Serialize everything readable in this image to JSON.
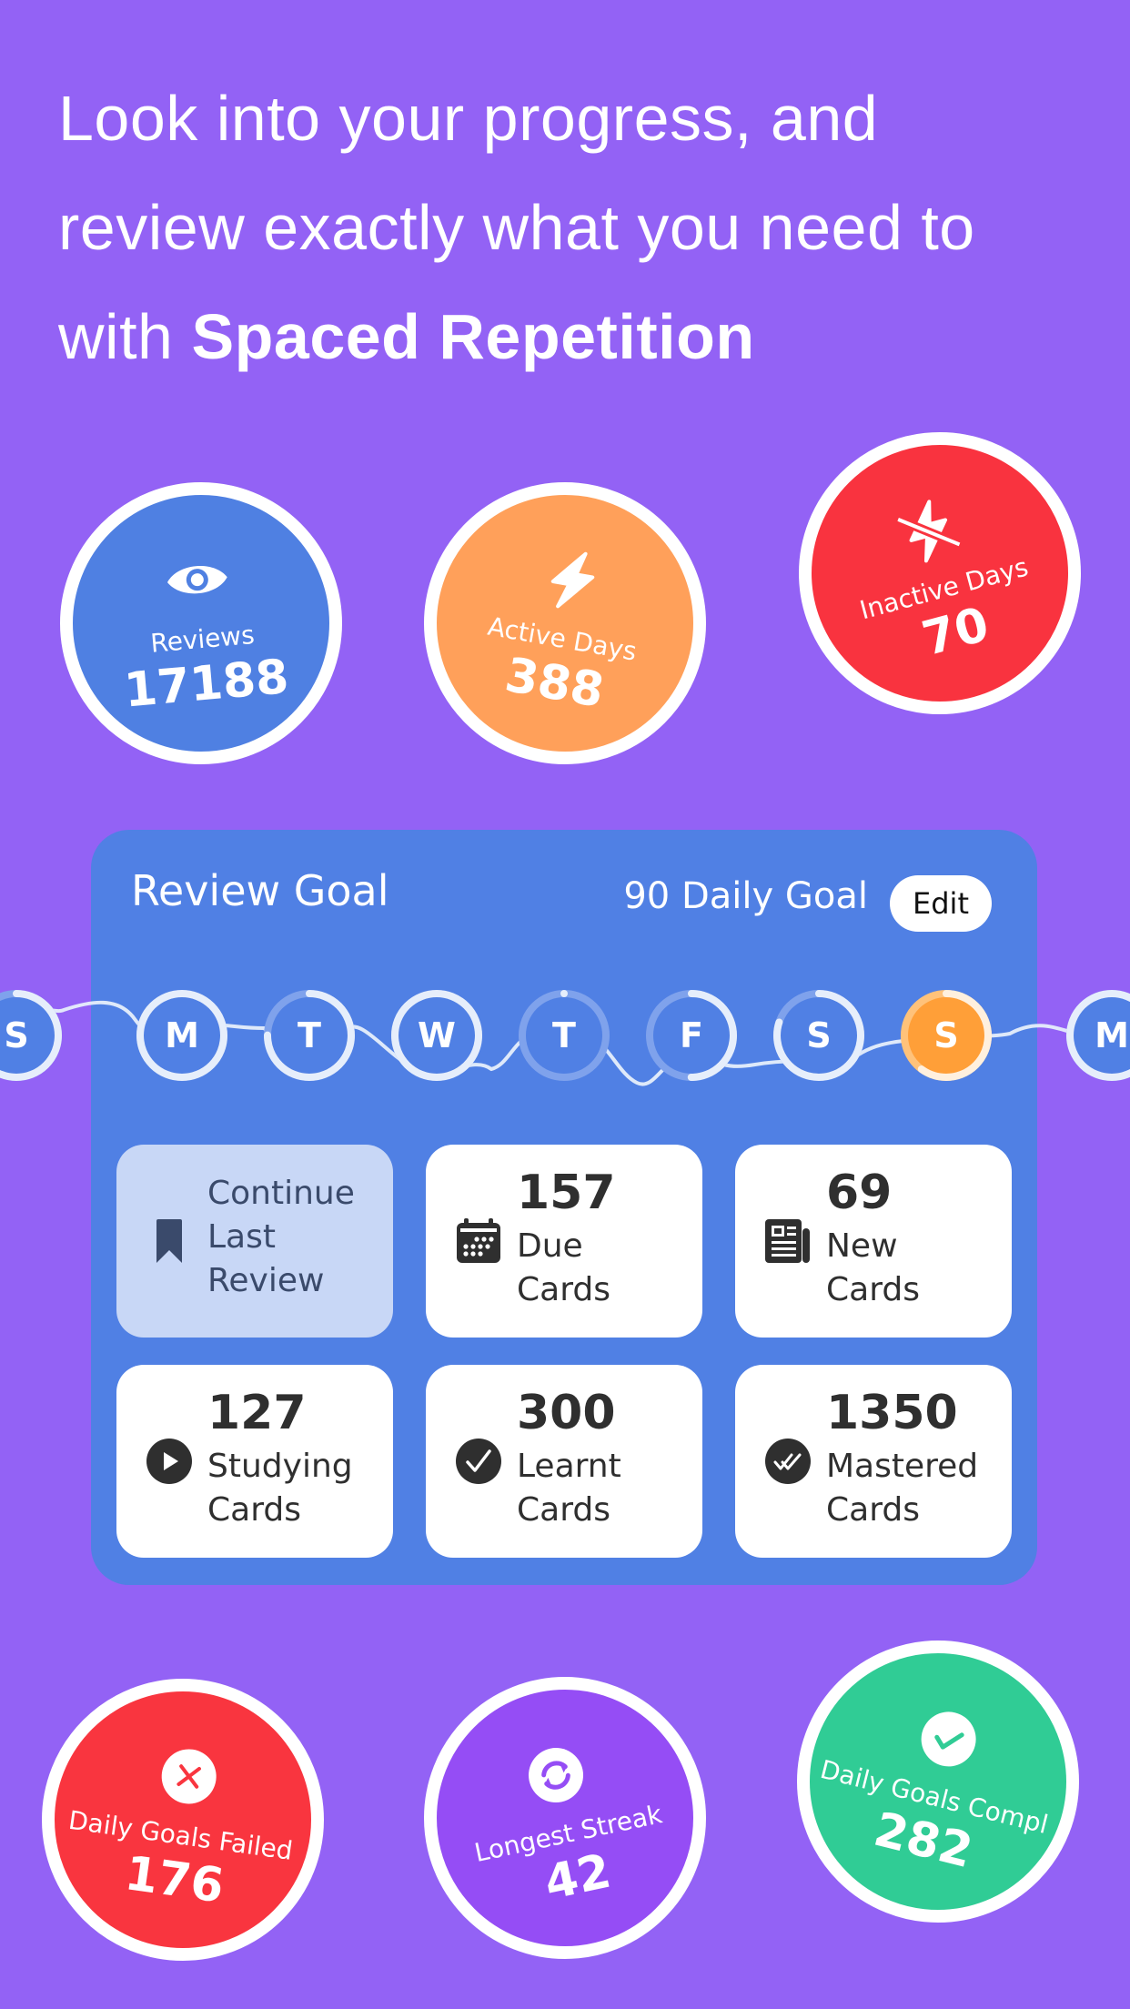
{
  "headline": {
    "line1": "Look into your progress, and",
    "line2": "review exactly what you need to",
    "line3_prefix": "with ",
    "line3_bold": "Spaced Repetition"
  },
  "colors": {
    "background": "#9362F5",
    "card": "#5080E4",
    "reviews": "#4F80E2",
    "active_days": "#FFA05A",
    "inactive_days": "#F9333F",
    "goals_failed": "#F9353F",
    "longest_streak": "#954DF5",
    "goals_completed": "#30CC95",
    "today": "#FF9F38"
  },
  "top_stats": [
    {
      "label": "Reviews",
      "value": "17188",
      "icon": "eye-icon"
    },
    {
      "label": "Active Days",
      "value": "388",
      "icon": "lightning-icon"
    },
    {
      "label": "Inactive Days",
      "value": "70",
      "icon": "lightning-off-icon"
    }
  ],
  "review_goal": {
    "title": "Review Goal",
    "daily_goal": "90 Daily Goal",
    "edit_label": "Edit",
    "days": [
      {
        "letter": "S",
        "progress": 0.85
      },
      {
        "letter": "M",
        "progress": 1.0
      },
      {
        "letter": "T",
        "progress": 0.75
      },
      {
        "letter": "W",
        "progress": 1.0
      },
      {
        "letter": "T",
        "progress": 0.0
      },
      {
        "letter": "F",
        "progress": 0.5
      },
      {
        "letter": "S",
        "progress": 0.8
      },
      {
        "letter": "S",
        "progress": 0.6,
        "today": true
      },
      {
        "letter": "M",
        "progress": 1.0
      }
    ],
    "tiles": [
      {
        "kind": "continue",
        "number": "",
        "label": "Continue\nLast\nReview",
        "icon": "bookmark-icon"
      },
      {
        "kind": "due",
        "number": "157",
        "label": "Due\nCards",
        "icon": "calendar-icon"
      },
      {
        "kind": "new",
        "number": "69",
        "label": "New\nCards",
        "icon": "newspaper-icon"
      },
      {
        "kind": "studying",
        "number": "127",
        "label": "Studying\nCards",
        "icon": "play-circle-icon"
      },
      {
        "kind": "learnt",
        "number": "300",
        "label": "Learnt\nCards",
        "icon": "check-circle-icon"
      },
      {
        "kind": "mastered",
        "number": "1350",
        "label": "Mastered\nCards",
        "icon": "double-check-circle-icon"
      }
    ]
  },
  "bottom_stats": [
    {
      "label": "Daily Goals Failed",
      "value": "176",
      "icon": "x-circle-icon"
    },
    {
      "label": "Longest Streak",
      "value": "42",
      "icon": "refresh-circle-icon"
    },
    {
      "label": "Daily Goals Compl",
      "value": "282",
      "icon": "check-circle-icon"
    }
  ]
}
